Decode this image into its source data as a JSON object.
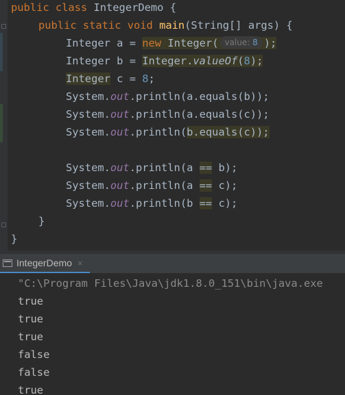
{
  "code": {
    "class_line": {
      "kw": "public class",
      "name": "IntegerDemo",
      "brace": "{"
    },
    "main_line": {
      "kw": "public static void",
      "fn": "main",
      "params": "(String[] args) {"
    },
    "line_a": {
      "type": "Integer",
      "var": "a = ",
      "new_kw": "new",
      "ctor": "Integer(",
      "hint_label": "value:",
      "hint_value": "8",
      "tail": ");"
    },
    "line_b": {
      "type": "Integer",
      "var": "b = ",
      "cls": "Integer.",
      "method": "valueOf",
      "open": "(",
      "num": "8",
      "tail": ");"
    },
    "line_c": {
      "type": "Integer",
      "var": "c = ",
      "num": "8",
      "tail": ";"
    },
    "println_prefix": "System.",
    "println_field": "out",
    "println_call": ".println(",
    "eq1": "a.equals(b));",
    "eq2": "a.equals(c));",
    "eq3_arg": "b.equals(c)",
    "eq3_tail": ");",
    "cmp1": {
      "left": "a ",
      "op": "==",
      "right": " b);"
    },
    "cmp2": {
      "left": "a ",
      "op": "==",
      "right": " c);"
    },
    "cmp3": {
      "left": "b ",
      "op": "==",
      "right": " c);"
    },
    "close_method": "}",
    "close_class": "}"
  },
  "run_panel": {
    "tab_label": "IntegerDemo",
    "close_glyph": "×"
  },
  "console": {
    "command": "\"C:\\Program Files\\Java\\jdk1.8.0_151\\bin\\java.exe",
    "output": [
      "true",
      "true",
      "true",
      "false",
      "false",
      "true"
    ]
  }
}
